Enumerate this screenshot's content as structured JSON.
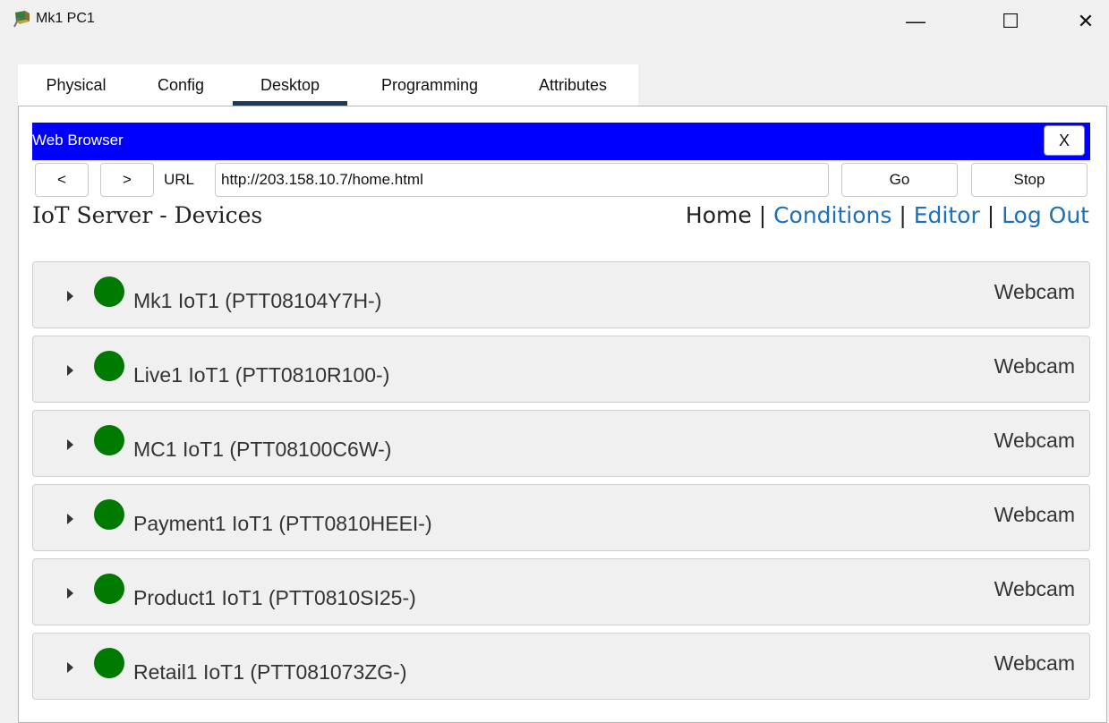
{
  "window": {
    "title": "Mk1 PC1",
    "minimize": "—",
    "maximize": "☐",
    "close": "✕"
  },
  "tabs": [
    {
      "label": "Physical"
    },
    {
      "label": "Config"
    },
    {
      "label": "Desktop",
      "active": true
    },
    {
      "label": "Programming"
    },
    {
      "label": "Attributes"
    }
  ],
  "browser": {
    "title": "Web Browser",
    "close_label": "X",
    "back_label": "<",
    "forward_label": ">",
    "url_label": "URL",
    "url_value": "http://203.158.10.7/home.html",
    "go_label": "Go",
    "stop_label": "Stop"
  },
  "page": {
    "title": "IoT Server - Devices",
    "nav": {
      "home": "Home",
      "conditions": "Conditions",
      "editor": "Editor",
      "logout": "Log Out",
      "separator": "|"
    }
  },
  "devices": [
    {
      "name": "Mk1 IoT1 (PTT08104Y7H-)",
      "type": "Webcam"
    },
    {
      "name": "Live1 IoT1 (PTT0810R100-)",
      "type": "Webcam"
    },
    {
      "name": "MC1 IoT1 (PTT08100C6W-)",
      "type": "Webcam"
    },
    {
      "name": "Payment1 IoT1 (PTT0810HEEI-)",
      "type": "Webcam"
    },
    {
      "name": "Product1 IoT1 (PTT0810SI25-)",
      "type": "Webcam"
    },
    {
      "name": "Retail1 IoT1 (PTT081073ZG-)",
      "type": "Webcam"
    }
  ],
  "colors": {
    "browser_bar": "#0000ff",
    "link": "#1b6fbd",
    "status_online": "#007a00",
    "tab_underline": "#1a3a5c"
  },
  "icons": {
    "app": "packet-tracer-pc-icon",
    "expand": "caret-right-icon",
    "status": "status-dot-icon"
  }
}
